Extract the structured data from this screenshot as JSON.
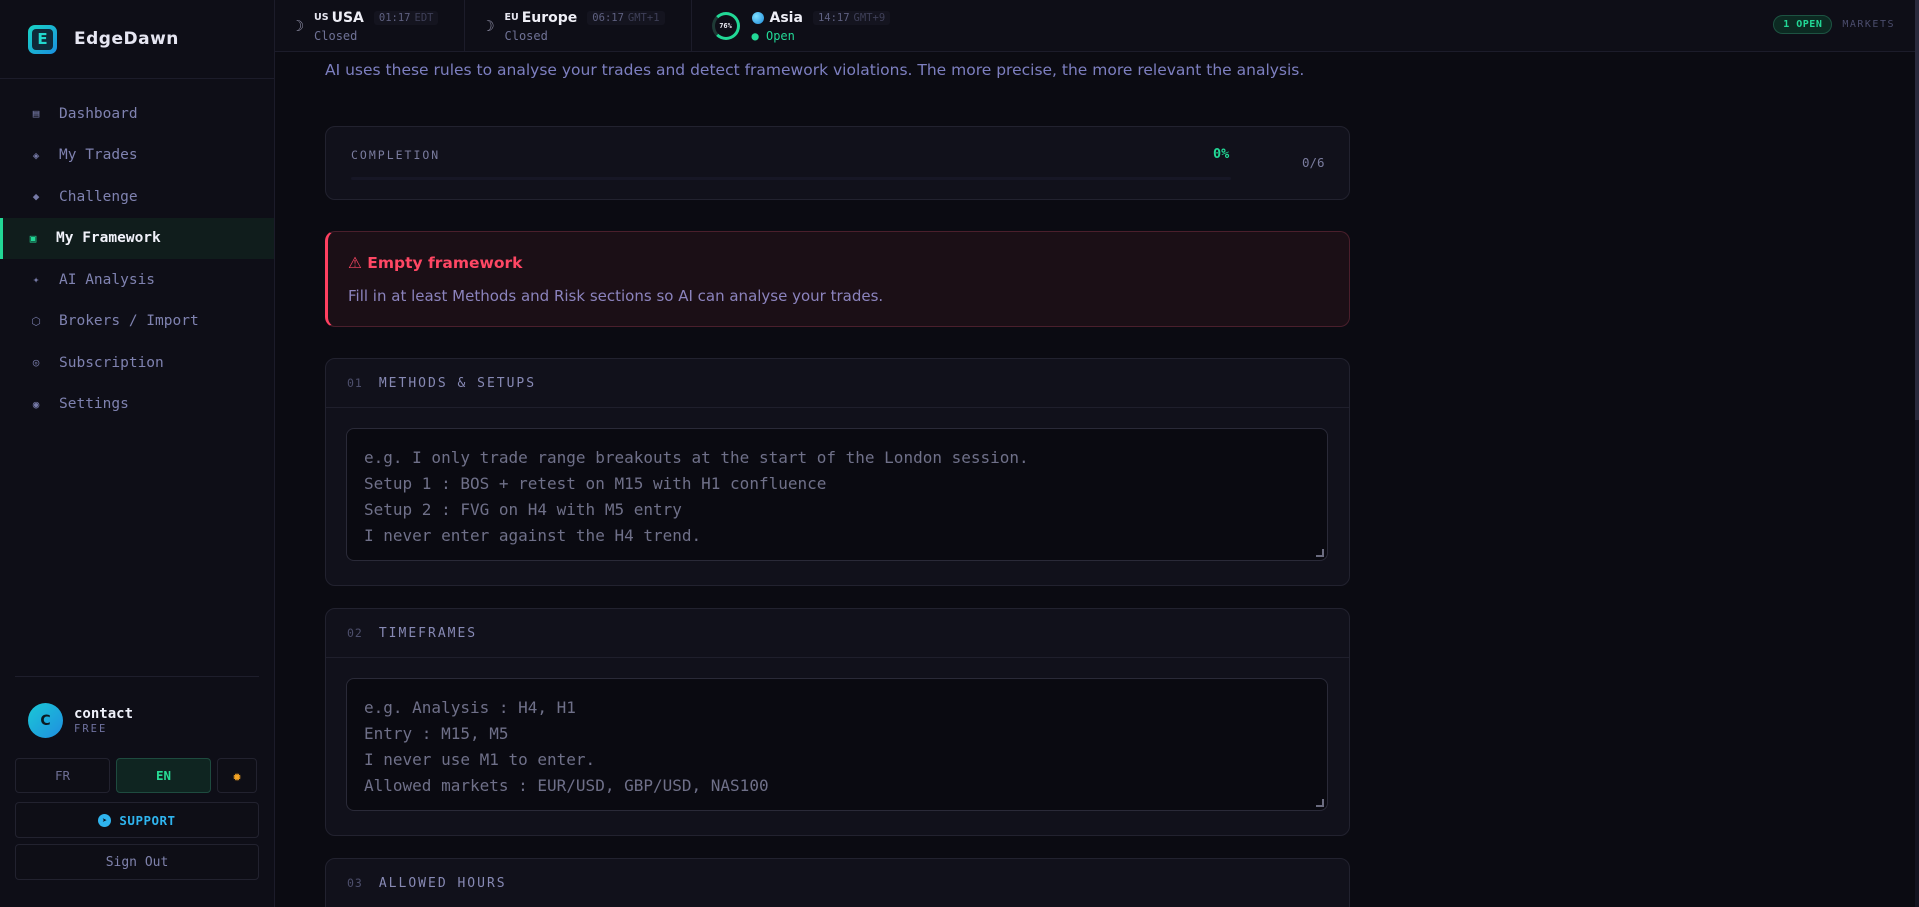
{
  "brand": {
    "name": "EdgeDawn",
    "logo_letter": "E"
  },
  "sidebar": {
    "items": [
      {
        "icon": "▤",
        "label": "Dashboard"
      },
      {
        "icon": "◈",
        "label": "My Trades"
      },
      {
        "icon": "◆",
        "label": "Challenge"
      },
      {
        "icon": "▣",
        "label": "My Framework",
        "active": true
      },
      {
        "icon": "✦",
        "label": "AI Analysis"
      },
      {
        "icon": "⬡",
        "label": "Brokers / Import"
      },
      {
        "icon": "◎",
        "label": "Subscription"
      },
      {
        "icon": "◉",
        "label": "Settings"
      }
    ],
    "user": {
      "initial": "C",
      "name": "contact",
      "plan": "FREE"
    },
    "lang": {
      "fr": "FR",
      "en": "EN",
      "active": "EN"
    },
    "support_label": "SUPPORT",
    "signout_label": "Sign Out"
  },
  "topbar": {
    "markets": [
      {
        "code": "US",
        "name": "USA",
        "time": "01:17",
        "tz": "EDT",
        "status": "Closed",
        "open": false
      },
      {
        "code": "EU",
        "name": "Europe",
        "time": "06:17",
        "tz": "GMT+1",
        "status": "Closed",
        "open": false
      },
      {
        "name": "Asia",
        "time": "14:17",
        "tz": "GMT+9",
        "status": "● Open",
        "open": true,
        "progress_label": "76%",
        "progress": 0.76
      }
    ],
    "open_count": "1 OPEN",
    "markets_label": "MARKETS"
  },
  "main": {
    "intro": "AI uses these rules to analyse your trades and detect framework violations. The more precise, the more relevant the analysis.",
    "completion": {
      "label": "COMPLETION",
      "percent": "0%",
      "count": "0/6",
      "progress": 0
    },
    "alert": {
      "title": "⚠ Empty framework",
      "text": "Fill in at least Methods and Risk sections so AI can analyse your trades."
    },
    "sections": [
      {
        "num": "01",
        "title": "METHODS & SETUPS",
        "placeholder": "e.g. I only trade range breakouts at the start of the London session.\nSetup 1 : BOS + retest on M15 with H1 confluence\nSetup 2 : FVG on H4 with M5 entry\nI never enter against the H4 trend."
      },
      {
        "num": "02",
        "title": "TIMEFRAMES",
        "placeholder": "e.g. Analysis : H4, H1\nEntry : M15, M5\nI never use M1 to enter.\nAllowed markets : EUR/USD, GBP/USD, NAS100"
      },
      {
        "num": "03",
        "title": "ALLOWED HOURS"
      }
    ]
  },
  "colors": {
    "accent": "#22d896",
    "danger": "#ff4764",
    "brand": "#1ac8d6"
  }
}
